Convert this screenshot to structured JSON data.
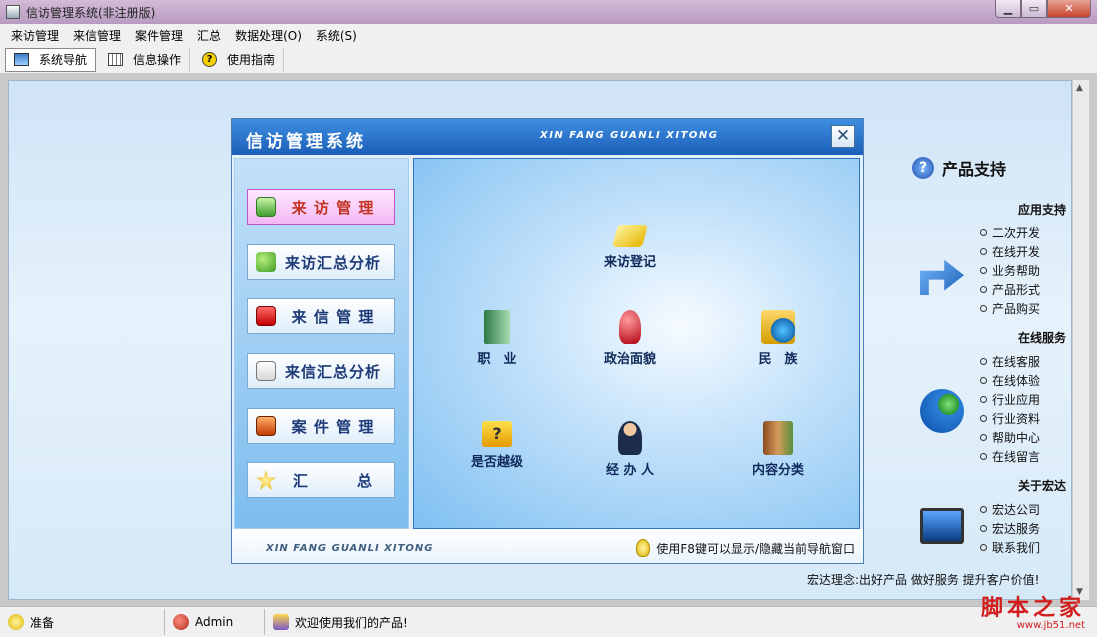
{
  "window": {
    "title": "信访管理系统(非注册版)"
  },
  "menu": [
    "来访管理",
    "来信管理",
    "案件管理",
    "汇总",
    "数据处理(O)",
    "系统(S)"
  ],
  "toolbar": {
    "nav": "系统导航",
    "info": "信息操作",
    "guide": "使用指南"
  },
  "dialog": {
    "title_cn": "信访管理系统",
    "title_en": "XIN FANG GUANLI XITONG",
    "footer_en": "XIN FANG GUANLI XITONG",
    "hint": "使用F8键可以显示/隐藏当前导航窗口",
    "nav": [
      "来 访 管 理",
      "来访汇总分析",
      "来 信 管 理",
      "来信汇总分析",
      "案 件 管 理",
      "汇　　　总"
    ],
    "features": {
      "register": "来访登记",
      "job": "职　业",
      "political": "政治面貌",
      "ethnic": "民　族",
      "escalate": "是否越级",
      "handler": "经 办 人",
      "category": "内容分类"
    }
  },
  "support": {
    "title": "产品支持",
    "app_head": "应用支持",
    "app_items": [
      "二次开发",
      "在线开发",
      "业务帮助",
      "产品形式",
      "产品购买"
    ],
    "online_head": "在线服务",
    "online_items": [
      "在线客服",
      "在线体验",
      "行业应用",
      "行业资料",
      "帮助中心",
      "在线留言"
    ],
    "about_head": "关于宏达",
    "about_items": [
      "宏达公司",
      "宏达服务",
      "联系我们"
    ]
  },
  "motto": "宏达理念:出好产品 做好服务 提升客户价值!",
  "status": {
    "ready": "准备",
    "user": "Admin",
    "welcome": "欢迎使用我们的产品!"
  },
  "watermark": {
    "text": "脚本之家",
    "url": "www.jb51.net"
  },
  "colors": {
    "title_bar": "#1a5fb8",
    "active_nav": "#f2b7f4",
    "active_nav_text": "#c23322",
    "nav_text": "#1d3a78"
  }
}
